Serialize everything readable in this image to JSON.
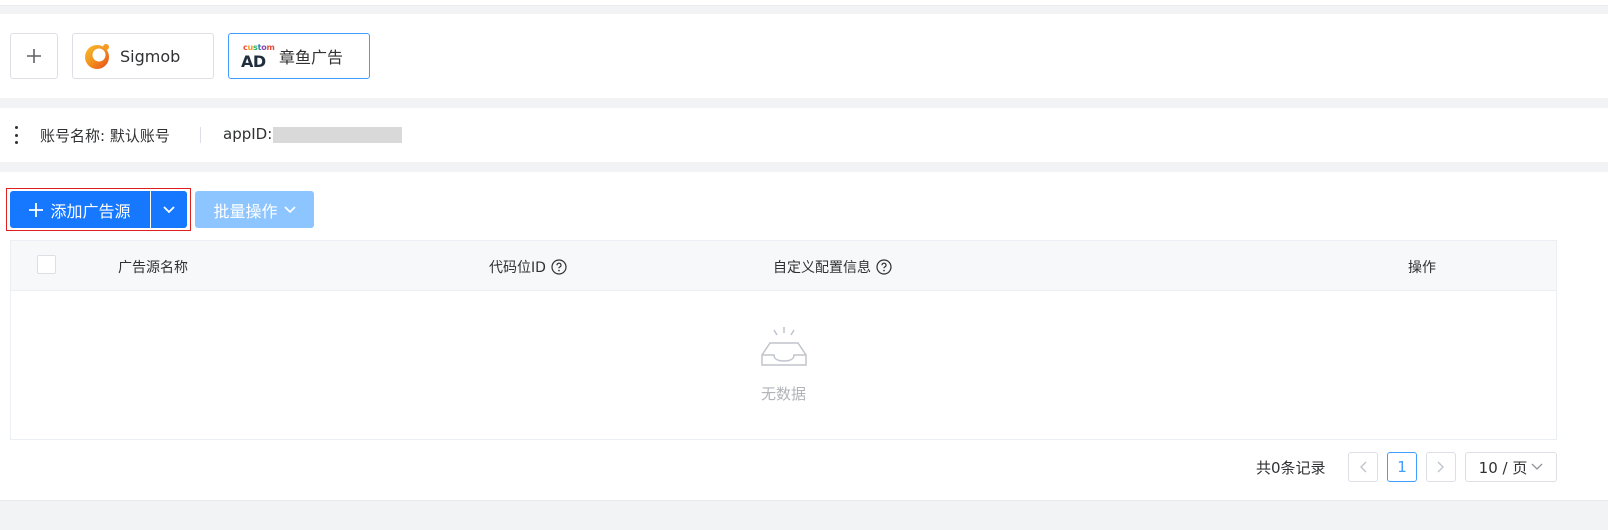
{
  "networks": {
    "add_label": "+",
    "items": [
      {
        "name": "Sigmob",
        "icon": "sigmob-logo"
      },
      {
        "name": "章鱼广告",
        "icon": "custom-ad-logo",
        "logo_small": "custom",
        "logo_big": "AD"
      }
    ]
  },
  "account": {
    "name": "账号名称: 默认账号",
    "appid_label": "appID:",
    "appid_value": ""
  },
  "toolbar": {
    "add_source": "添加广告源",
    "batch": "批量操作"
  },
  "table": {
    "columns": [
      "广告源名称",
      "代码位ID",
      "自定义配置信息",
      "操作"
    ],
    "rows": [],
    "empty_text": "无数据"
  },
  "pagination": {
    "total_text": "共0条记录",
    "current_page": "1",
    "page_size": "10 / 页"
  },
  "colors": {
    "primary": "#1677ff",
    "primary_disabled": "#8cc5ff",
    "highlight": "#e02020"
  }
}
